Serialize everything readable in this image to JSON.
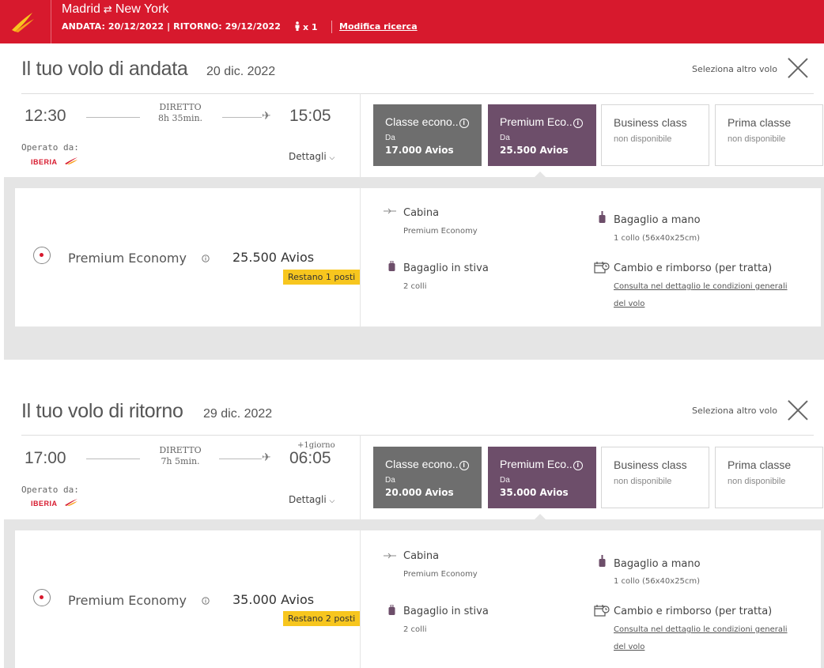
{
  "header": {
    "origin": "Madrid",
    "swap_glyph": "⇄",
    "destination": "New York",
    "dates": "ANDATA: 20/12/2022 | RITORNO: 29/12/2022",
    "passengers": "x 1",
    "modify_label": "Modifica ricerca",
    "brand_color": "#d7192d"
  },
  "outbound": {
    "title": "Il tuo volo di andata",
    "date": "20 dic. 2022",
    "select_other": "Seleziona altro volo",
    "departure": "12:30",
    "arrival": "15:05",
    "next_day": "",
    "type": "DIRETTO",
    "duration": "8h 35min.",
    "operated_by": "Operato da:",
    "airline": "IBERIA",
    "details": "Dettagli",
    "classes": [
      {
        "name": "Classe econo..",
        "from": "Da",
        "price": "17.000 Avios",
        "color": "#6e6e6e"
      },
      {
        "name": "Premium Eco..",
        "from": "Da",
        "price": "25.500 Avios",
        "color": "#6d4e6a"
      },
      {
        "name": "Business class",
        "status": "non disponibile"
      },
      {
        "name": "Prima classe",
        "status": "non disponibile"
      }
    ],
    "fare": {
      "name": "Premium Economy",
      "price": "25.500 Avios",
      "seats_left": "Restano 1 posti"
    },
    "features": {
      "cabin_title": "Cabina",
      "cabin_value": "Premium Economy",
      "hand_title": "Bagaglio a mano",
      "hand_value": "1 collo (56x40x25cm)",
      "hold_title": "Bagaglio in stiva",
      "hold_value": "2 colli",
      "change_title": "Cambio e rimborso (per tratta)",
      "change_link": "Consulta nel dettaglio le condizioni generali del volo"
    }
  },
  "return": {
    "title": "Il tuo volo di ritorno",
    "date": "29 dic. 2022",
    "select_other": "Seleziona altro volo",
    "departure": "17:00",
    "arrival": "06:05",
    "next_day": "+1giorno",
    "type": "DIRETTO",
    "duration": "7h 5min.",
    "operated_by": "Operato da:",
    "airline": "IBERIA",
    "details": "Dettagli",
    "classes": [
      {
        "name": "Classe econo..",
        "from": "Da",
        "price": "20.000 Avios",
        "color": "#6e6e6e"
      },
      {
        "name": "Premium Eco..",
        "from": "Da",
        "price": "35.000 Avios",
        "color": "#6d4e6a"
      },
      {
        "name": "Business class",
        "status": "non disponibile"
      },
      {
        "name": "Prima classe",
        "status": "non disponibile"
      }
    ],
    "fare": {
      "name": "Premium Economy",
      "price": "35.000 Avios",
      "seats_left": "Restano 2 posti"
    },
    "features": {
      "cabin_title": "Cabina",
      "cabin_value": "Premium Economy",
      "hand_title": "Bagaglio a mano",
      "hand_value": "1 collo (56x40x25cm)",
      "hold_title": "Bagaglio in stiva",
      "hold_value": "2 colli",
      "change_title": "Cambio e rimborso (per tratta)",
      "change_link": "Consulta nel dettaglio le condizioni generali del volo"
    }
  }
}
